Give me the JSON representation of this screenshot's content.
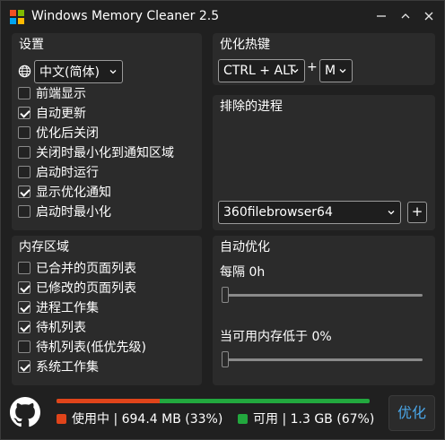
{
  "window": {
    "title": "Windows Memory Cleaner 2.5"
  },
  "settings": {
    "title": "设置",
    "language": "中文(简体)",
    "options": [
      {
        "label": "前端显示",
        "checked": false
      },
      {
        "label": "自动更新",
        "checked": true
      },
      {
        "label": "优化后关闭",
        "checked": false
      },
      {
        "label": "关闭时最小化到通知区域",
        "checked": false
      },
      {
        "label": "启动时运行",
        "checked": false
      },
      {
        "label": "显示优化通知",
        "checked": true
      },
      {
        "label": "启动时最小化",
        "checked": false
      }
    ]
  },
  "hotkey": {
    "title": "优化热键",
    "modifier": "CTRL + ALT",
    "plus": "+",
    "key": "M"
  },
  "exclusions": {
    "title": "排除的进程",
    "process": "360filebrowser64",
    "add_label": "+"
  },
  "memory_areas": {
    "title": "内存区域",
    "options": [
      {
        "label": "已合并的页面列表",
        "checked": false
      },
      {
        "label": "已修改的页面列表",
        "checked": true
      },
      {
        "label": "进程工作集",
        "checked": true
      },
      {
        "label": "待机列表",
        "checked": true
      },
      {
        "label": "待机列表(低优先级)",
        "checked": false
      },
      {
        "label": "系统工作集",
        "checked": true
      }
    ]
  },
  "auto_optimize": {
    "title": "自动优化",
    "interval_label": "每隔 0h",
    "interval_value": 0,
    "threshold_label": "当可用内存低于 0%",
    "threshold_value": 0
  },
  "status": {
    "used_label": "使用中 | 694.4 MB (33%)",
    "used_percent": 33,
    "free_label": "可用 | 1.3 GB (67%)",
    "free_percent": 67,
    "optimize_label": "优化",
    "colors": {
      "used": "#e0441a",
      "free": "#22a83e",
      "accent": "#4aa6e8"
    }
  }
}
